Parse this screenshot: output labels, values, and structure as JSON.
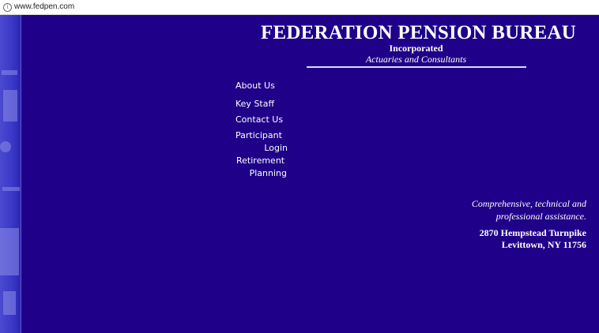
{
  "browser": {
    "url": "www.fedpen.com"
  },
  "header": {
    "title": "FEDERATION PENSION BUREAU",
    "subtitle": "Incorporated",
    "tagline": "Actuaries and Consultants"
  },
  "nav": {
    "items": [
      {
        "label": "About Us"
      },
      {
        "label": "Key Staff"
      },
      {
        "label": "Contact Us"
      },
      {
        "label_line1": "Participant",
        "label_line2": "Login"
      },
      {
        "label_line1": "Retirement",
        "label_line2": "Planning"
      }
    ]
  },
  "info": {
    "assist_line1": "Comprehensive, technical and",
    "assist_line2": "professional assistance.",
    "address_line1": "2870 Hempstead Turnpike",
    "address_line2": "Levittown, NY 11756"
  },
  "colors": {
    "background": "#1f0089",
    "sidebar": "#4a4ad0",
    "text": "#ffffff"
  }
}
